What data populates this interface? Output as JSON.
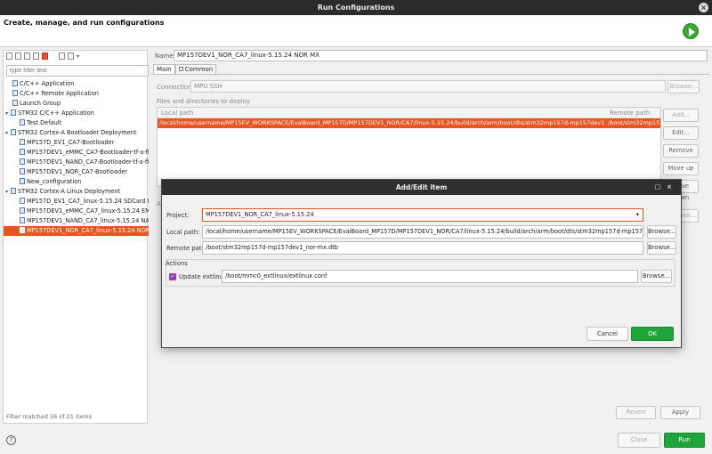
{
  "window": {
    "title": "Run Configurations",
    "close_glyph": "×"
  },
  "header": {
    "subtitle": "Create, manage, and run configurations",
    "run_icon": "run-icon"
  },
  "left": {
    "filter_placeholder": "type filter text",
    "tree": [
      {
        "label": "C/C++ Application",
        "level": 1
      },
      {
        "label": "C/C++ Remote Application",
        "level": 1
      },
      {
        "label": "Launch Group",
        "level": 1
      },
      {
        "label": "STM32 C/C++ Application",
        "level": 0,
        "expander": "▾"
      },
      {
        "label": "Test Default",
        "level": 2
      },
      {
        "label": "STM32 Cortex-A Bootloader Deployment",
        "level": 0,
        "expander": "▾"
      },
      {
        "label": "MP157D_EV1_CA7-Bootloader",
        "level": 2
      },
      {
        "label": "MP157DEV1_eMMC_CA7-Bootloader-tf-a-fip-eM",
        "level": 2
      },
      {
        "label": "MP157DEV1_NAND_CA7-Bootloader-tf-a-fip-NA",
        "level": 2
      },
      {
        "label": "MP157DEV1_NOR_CA7-Bootloader",
        "level": 2
      },
      {
        "label": "New_configuration",
        "level": 2
      },
      {
        "label": "STM32 Cortex-A Linux Deployment",
        "level": 0,
        "expander": "▾"
      },
      {
        "label": "MP157D_EV1_CA7_linux-5.15.24 SDCard MX",
        "level": 2
      },
      {
        "label": "MP157DEV1_eMMC_CA7_linux-5.15.24 EMMC M",
        "level": 2
      },
      {
        "label": "MP157DEV1_NAND_CA7_linux-5.15.24 NAND M",
        "level": 2
      },
      {
        "label": "MP157DEV1_NOR_CA7_linux-5.15.24 NOR MX",
        "level": 2,
        "selected": true
      }
    ],
    "status": "Filter matched 16 of 21 items"
  },
  "right": {
    "name_label": "Name:",
    "name_value": "MP157DEV1_NOR_CA7_linux-5.15.24 NOR MX",
    "tabs": {
      "main": "Main",
      "common": "Common"
    },
    "connection_label": "Connection:",
    "connection_value": "MPU SSH",
    "browse": "Browse...",
    "files_label": "Files and directories to deploy",
    "col_local": "Local path",
    "col_remote": "Remote path",
    "row_local": "/local/home/username/MP15EV_WORKSPACE/EvalBoard_MP157D/MP157DEV1_NOR/CA7/linux-5.15.24/build/arch/arm/boot/dts/stm32mp157d-mp157dev1_nor-mx.dtb",
    "row_remote": "/boot/stm32mp157",
    "side_buttons": {
      "add": "Add...",
      "edit": "Edit...",
      "remove": "Remove",
      "move_up": "Move up",
      "move_down": "Move down",
      "browse_partial": "owse..."
    },
    "obscured_label": "Ac",
    "revert": "Revert",
    "apply": "Apply"
  },
  "footer": {
    "help_glyph": "?",
    "close": "Close",
    "run": "Run"
  },
  "dialog": {
    "title": "Add/Edit item",
    "ctrl_min": "□",
    "ctrl_close": "×",
    "project_label": "Project:",
    "project_value": "MP157DEV1_NOR_CA7_linux-5.15.24",
    "dropdown_glyph": "▾",
    "local_path_label": "Local path:",
    "local_path_value": "/local/home/username/MP15EV_WORKSPACE/EvalBoard_MP157D/MP157DEV1_NOR/CA7/linux-5.15.24/build/arch/arm/boot/dts/stm32mp157d-mp157dev1_nor-mx.dtb",
    "remote_path_label": "Remote path:",
    "remote_path_value": "/boot/stm32mp157d-mp157dev1_nor-mx.dtb",
    "actions_label": "Actions",
    "update_label": "Update extlinux:",
    "update_checked": true,
    "check_glyph": "✓",
    "extlinux_value": "/boot/mmc0_extlinux/extlinux.conf",
    "browse": "Browse...",
    "cancel": "Cancel",
    "ok": "OK"
  },
  "colors": {
    "accent": "#e95420",
    "ok_green": "#1fa53a",
    "titlebar": "#2b2b2b"
  }
}
